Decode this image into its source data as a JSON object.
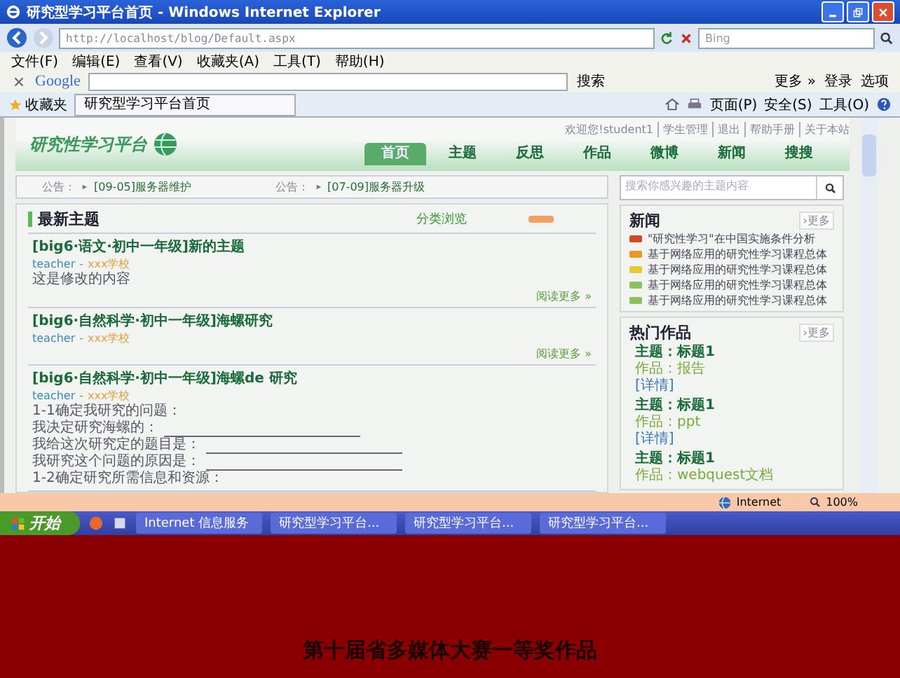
{
  "window": {
    "title": "研究型学习平台首页 - Windows Internet Explorer"
  },
  "address_bar": {
    "url": "http://localhost/blog/Default.aspx",
    "search_placeholder": "Bing"
  },
  "menu": [
    "文件(F)",
    "编辑(E)",
    "查看(V)",
    "收藏夹(A)",
    "工具(T)",
    "帮助(H)"
  ],
  "google_toolbar": {
    "logo": "Google",
    "search_button": "搜索",
    "more": "更多 »",
    "login": "登录",
    "options": "选项"
  },
  "favorites_bar": {
    "favorites": "收藏夹",
    "tab": "研究型学习平台首页",
    "tools": [
      "页面(P)",
      "安全(S)",
      "工具(O)"
    ]
  },
  "page": {
    "logo_text": "研究性学习平台",
    "top_links": [
      "欢迎您!student1",
      "学生管理",
      "退出",
      "帮助手册",
      "关于本站"
    ],
    "nav": [
      {
        "label": "首页",
        "selected": true
      },
      {
        "label": "主题",
        "selected": false
      },
      {
        "label": "反思",
        "selected": false
      },
      {
        "label": "作品",
        "selected": false
      },
      {
        "label": "微博",
        "selected": false
      },
      {
        "label": "新闻",
        "selected": false
      },
      {
        "label": "搜搜",
        "selected": false
      }
    ],
    "notices": [
      {
        "label": "公告：",
        "text": "[09-05]服务器维护"
      },
      {
        "label": "公告：",
        "text": "[07-09]服务器升级"
      }
    ],
    "search_placeholder": "搜索你感兴趣的主题内容",
    "latest": {
      "title": "最新主题",
      "browse": "分类浏览",
      "topics": [
        {
          "title": "[big6·语文·初中一年级]新的主题",
          "author": "teacher",
          "separator": "-",
          "school": "xxx学校",
          "lines": [
            {
              "text": "这是修改的内容",
              "blank": false
            }
          ],
          "read_more": "阅读更多 »"
        },
        {
          "title": "[big6·自然科学·初中一年级]海螺研究",
          "author": "teacher",
          "separator": "-",
          "school": "xxx学校",
          "read_more": "阅读更多 »"
        },
        {
          "title": "[big6·自然科学·初中一年级]海螺de 研究",
          "author": "teacher",
          "separator": "-",
          "school": "xxx学校",
          "lines": [
            {
              "text": "1-1确定我研究的问题：",
              "blank": false
            },
            {
              "text": "我决定研究海螺的：",
              "blank": true
            },
            {
              "text": "我给这次研究定的题目是：",
              "blank": true
            },
            {
              "text": "我研究这个问题的原因是：",
              "blank": true
            },
            {
              "text": "1-2确定研究所需信息和资源：",
              "blank": false
            }
          ]
        }
      ]
    },
    "news": {
      "title": "新闻",
      "more": "›更多",
      "items": [
        {
          "text": "\"研究性学习\"在中国实施条件分析",
          "color": "#d04828"
        },
        {
          "text": "基于网络应用的研究性学习课程总体",
          "color": "#e89a28"
        },
        {
          "text": "基于网络应用的研究性学习课程总体",
          "color": "#e8c830"
        },
        {
          "text": "基于网络应用的研究性学习课程总体",
          "color": "#8cc060"
        },
        {
          "text": "基于网络应用的研究性学习课程总体",
          "color": "#8cc060"
        }
      ]
    },
    "works": {
      "title": "热门作品",
      "more": "›更多",
      "items": [
        {
          "subject": "主题：标题1",
          "work": "作品：报告",
          "detail": "[详情]"
        },
        {
          "subject": "主题：标题1",
          "work": "作品：ppt",
          "detail": "[详情]"
        },
        {
          "subject": "主题：标题1",
          "work": "作品：webquest文档"
        }
      ]
    }
  },
  "status_bar": {
    "zone": "Internet",
    "zoom": "100%"
  },
  "taskbar": {
    "start": "开始",
    "tasks": [
      "Internet 信息服务",
      "研究型学习平台...",
      "研究型学习平台...",
      "研究型学习平台..."
    ]
  },
  "caption": "第十届省多媒体大赛一等奖作品"
}
